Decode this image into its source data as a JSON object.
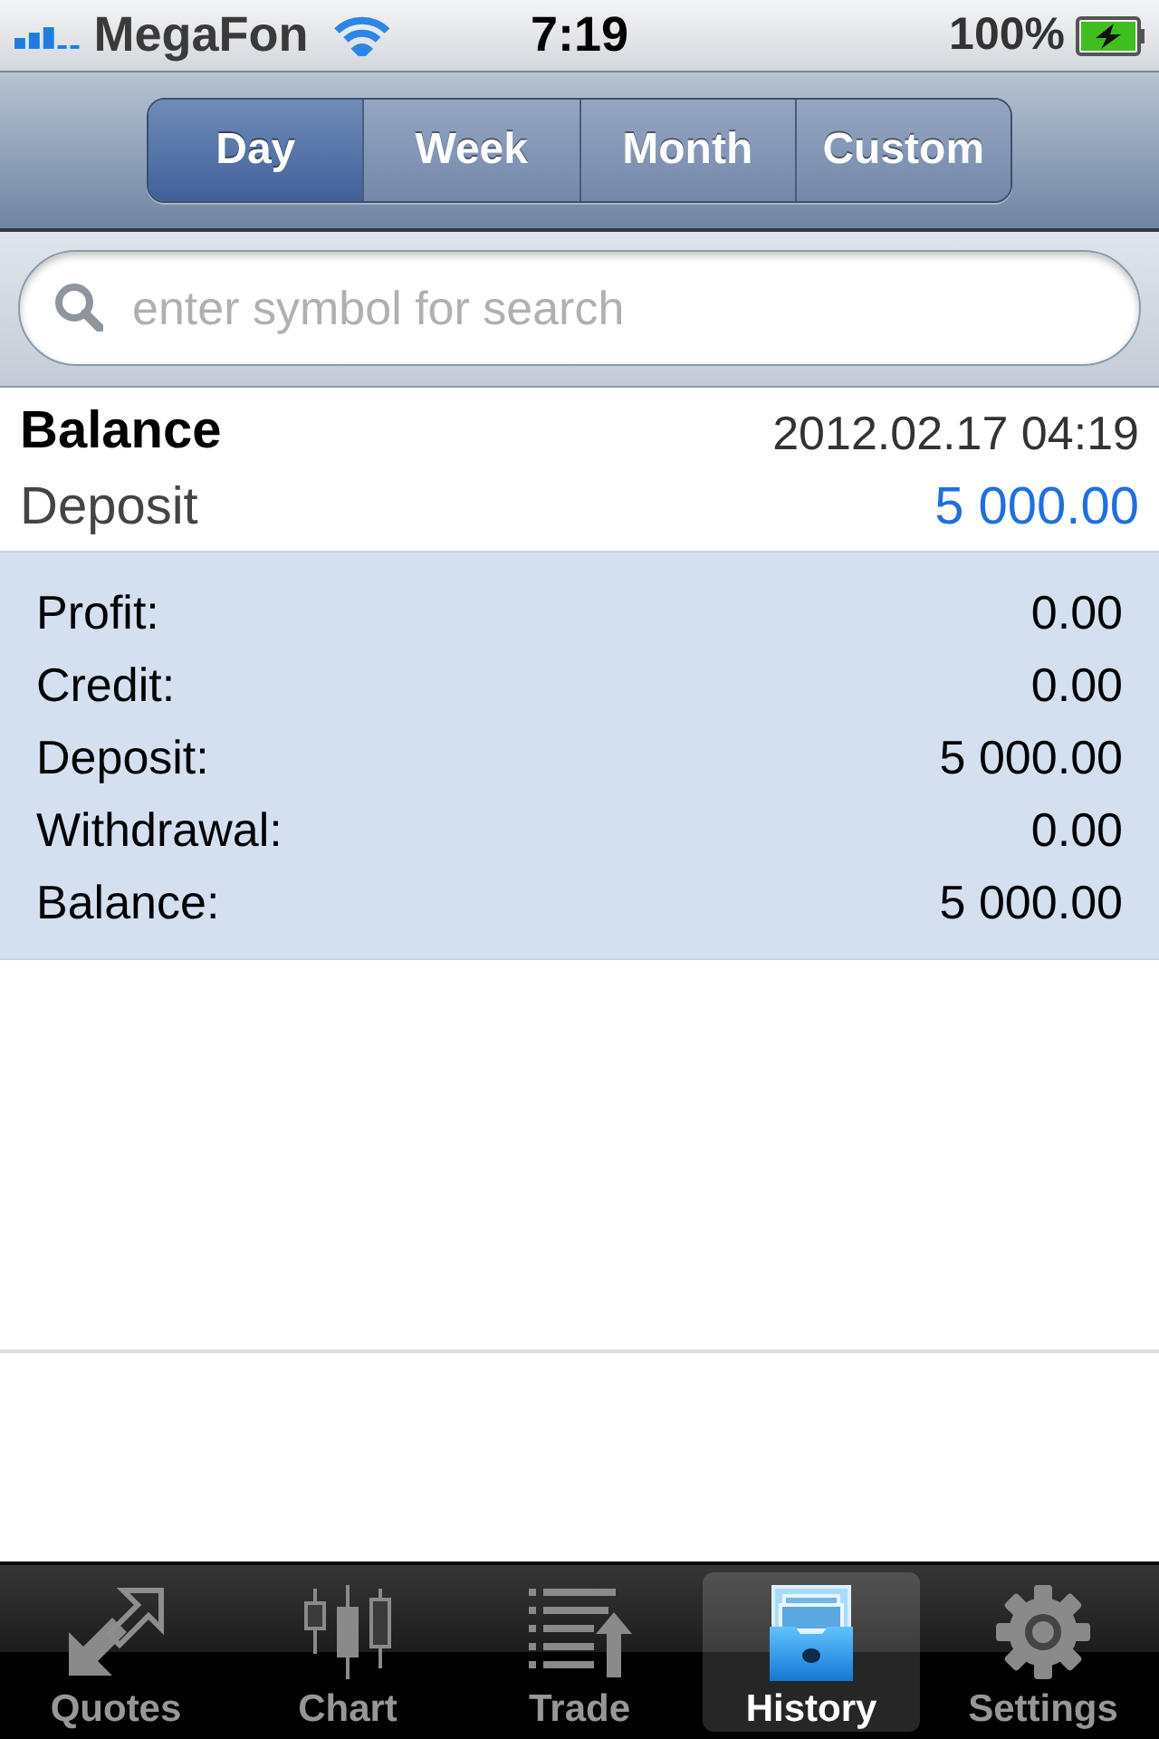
{
  "status_bar": {
    "carrier": "MegaFon",
    "time": "7:19",
    "battery": "100%"
  },
  "period_tabs": [
    {
      "label": "Day",
      "selected": true
    },
    {
      "label": "Week",
      "selected": false
    },
    {
      "label": "Month",
      "selected": false
    },
    {
      "label": "Custom",
      "selected": false
    }
  ],
  "search": {
    "placeholder": "enter symbol for search"
  },
  "entries": [
    {
      "title": "Balance",
      "time": "2012.02.17 04:19",
      "type": "Deposit",
      "amount": "5 000.00"
    }
  ],
  "summary": [
    {
      "label": "Profit:",
      "value": "0.00"
    },
    {
      "label": "Credit:",
      "value": "0.00"
    },
    {
      "label": "Deposit:",
      "value": "5 000.00"
    },
    {
      "label": "Withdrawal:",
      "value": "0.00"
    },
    {
      "label": "Balance:",
      "value": "5 000.00"
    }
  ],
  "tab_bar": [
    {
      "label": "Quotes",
      "selected": false
    },
    {
      "label": "Chart",
      "selected": false
    },
    {
      "label": "Trade",
      "selected": false
    },
    {
      "label": "History",
      "selected": true
    },
    {
      "label": "Settings",
      "selected": false
    }
  ]
}
